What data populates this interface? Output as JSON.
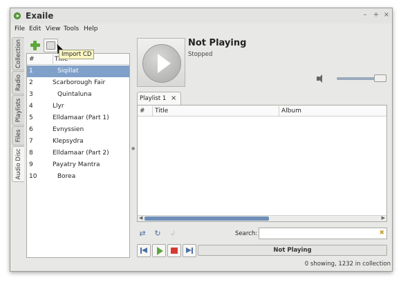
{
  "window": {
    "title": "Exaile",
    "controls": [
      "–",
      "+",
      "×"
    ]
  },
  "menu": [
    "File",
    "Edit",
    "View",
    "Tools",
    "Help"
  ],
  "side_tabs": [
    "Collection",
    "Radio",
    "Playlists",
    "Files",
    "Audio Disc"
  ],
  "active_side_tab": "Audio Disc",
  "toolbar": {
    "tooltip": "Import CD"
  },
  "track_list": {
    "columns": [
      "#",
      "Title"
    ],
    "rows": [
      {
        "num": "1",
        "title": "Siqillat",
        "selected": true
      },
      {
        "num": "2",
        "title": "Scarborough Fair"
      },
      {
        "num": "3",
        "title": "Quintaluna"
      },
      {
        "num": "4",
        "title": "Llyr"
      },
      {
        "num": "5",
        "title": "Elldamaar (Part 1)"
      },
      {
        "num": "6",
        "title": "Evnyssien"
      },
      {
        "num": "7",
        "title": "Klepsydra"
      },
      {
        "num": "8",
        "title": "Elldamaar (Part 2)"
      },
      {
        "num": "9",
        "title": "Payatry Mantra"
      },
      {
        "num": "10",
        "title": "Borea"
      }
    ]
  },
  "now_playing": {
    "title": "Not Playing",
    "status": "Stopped"
  },
  "volume": {
    "level": 0.85
  },
  "playlist": {
    "tab_label": "Playlist 1",
    "tab_close": "×",
    "columns": [
      "#",
      "Title",
      "Album"
    ]
  },
  "search": {
    "label": "Search:",
    "value": ""
  },
  "progress_label": "Not Playing",
  "status_text": "0 showing, 1232 in collection",
  "colors": {
    "selection": "#7fa0c9",
    "accent": "#4a6fa5",
    "stop": "#d63a32",
    "play": "#5da83b"
  }
}
